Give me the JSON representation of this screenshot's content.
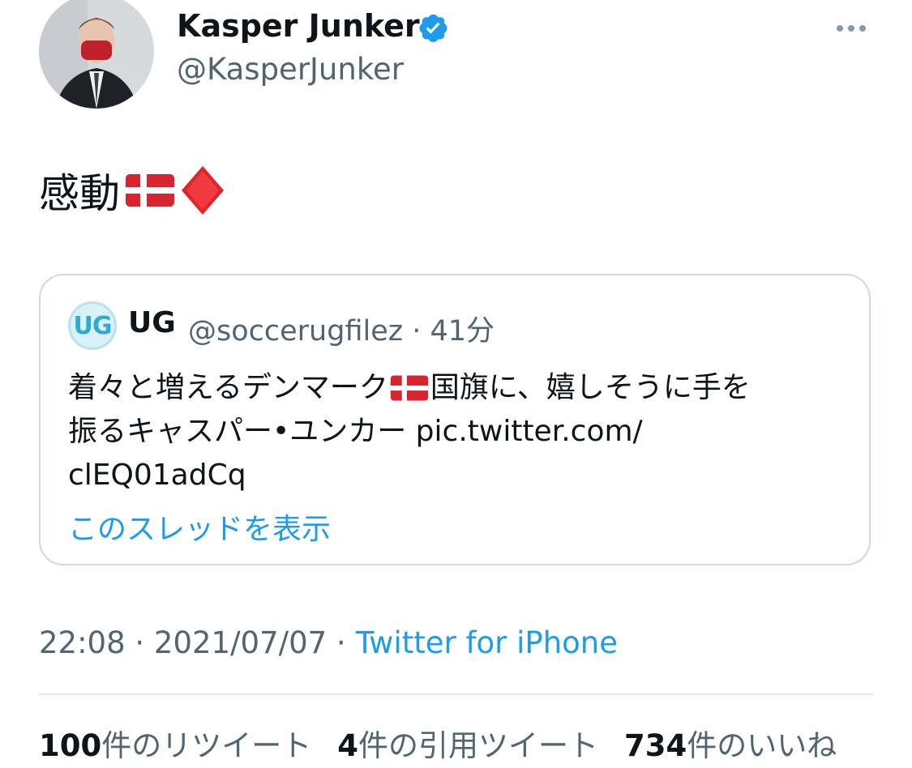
{
  "author": {
    "name": "Kasper Junker",
    "handle": "@KasperJunker",
    "verified": true
  },
  "tweet": {
    "text": "感動",
    "emojis": [
      "denmark-flag",
      "red-diamond"
    ]
  },
  "quoted": {
    "avatar_logo": "UG",
    "name": "UG",
    "handle_time": "@soccerugfilez · 41分",
    "line1_a": "着々と増えるデンマーク",
    "line1_b": "国旗に、嬉しそうに手を",
    "line2": "振るキャスパー•ユンカー pic.twitter.com/",
    "line3": "clEQ01adCq",
    "show_thread": "このスレッドを表示"
  },
  "meta": {
    "time": "22:08 · 2021/07/07 ·",
    "source": "Twitter for iPhone"
  },
  "stats": {
    "retweets_num": "100",
    "retweets_label": "件のリツイート",
    "quotes_num": "4",
    "quotes_label": "件の引用ツイート",
    "likes_num": "734",
    "likes_label": "件のいいね"
  },
  "colors": {
    "accent": "#1d9bf0",
    "secondary_text": "#536471",
    "border": "#cfd9de"
  }
}
